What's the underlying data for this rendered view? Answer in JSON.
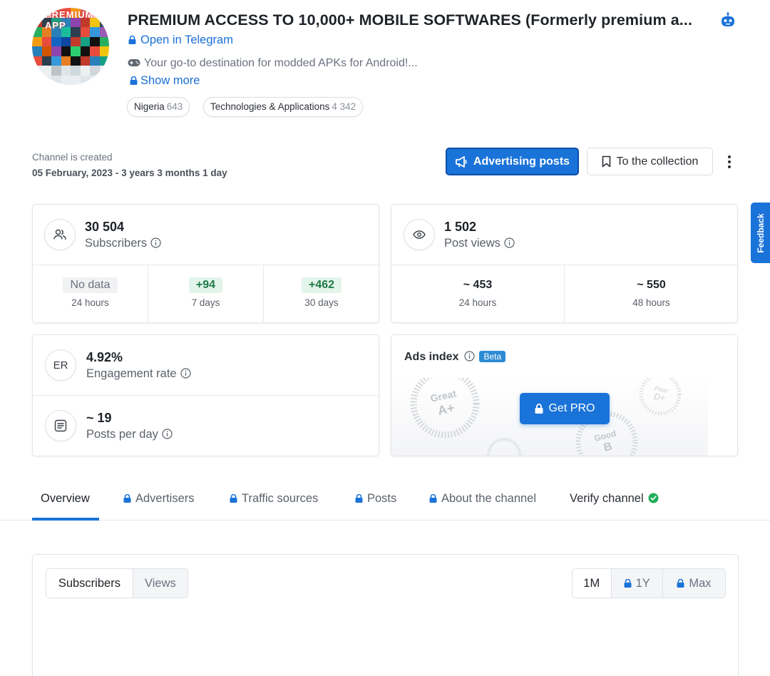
{
  "header": {
    "title": "PREMIUM ACCESS TO 10,000+ MOBILE SOFTWARES (Formerly premium a...",
    "avatar_text": "PREMIUM APP",
    "open_link": "Open in Telegram",
    "description": "Your go-to destination for modded APKs for Android!...",
    "show_more": "Show more"
  },
  "chips": [
    {
      "label": "Nigeria",
      "count": "643"
    },
    {
      "label": "Technologies & Applications",
      "count": "4 342"
    }
  ],
  "created": {
    "label": "Channel is created",
    "value": "05 February, 2023 - 3 years 3 months 1 day"
  },
  "actions": {
    "advertising": "Advertising posts",
    "collection": "To the collection"
  },
  "feedback": "Feedback",
  "subscribers": {
    "value": "30 504",
    "label": "Subscribers",
    "periods": [
      {
        "value": "No data",
        "label": "24 hours"
      },
      {
        "value": "+94",
        "label": "7 days"
      },
      {
        "value": "+462",
        "label": "30 days"
      }
    ]
  },
  "views": {
    "value": "1 502",
    "label": "Post views",
    "periods": [
      {
        "value": "~ 453",
        "label": "24 hours"
      },
      {
        "value": "~ 550",
        "label": "48 hours"
      }
    ]
  },
  "er": {
    "icon_text": "ER",
    "value": "4.92%",
    "label": "Engagement rate"
  },
  "posts": {
    "value": "~ 19",
    "label": "Posts per day"
  },
  "ads_index": {
    "title": "Ads index",
    "beta": "Beta",
    "get_pro": "Get PRO",
    "badges": [
      {
        "word": "Great",
        "grade": "A+"
      },
      {
        "word": "Poor",
        "grade": "D+"
      },
      {
        "word": "Good",
        "grade": "B"
      }
    ]
  },
  "tabs": [
    {
      "label": "Overview",
      "locked": false
    },
    {
      "label": "Advertisers",
      "locked": true
    },
    {
      "label": "Traffic sources",
      "locked": true
    },
    {
      "label": "Posts",
      "locked": true
    },
    {
      "label": "About the channel",
      "locked": true
    },
    {
      "label": "Verify channel",
      "locked": false
    }
  ],
  "chart_controls": {
    "metrics": [
      "Subscribers",
      "Views"
    ],
    "ranges": [
      "1M",
      "1Y",
      "Max"
    ]
  },
  "colors": {
    "accent": "#1a73d9",
    "positive": "#1e7a46",
    "verified": "#1fae5b"
  }
}
